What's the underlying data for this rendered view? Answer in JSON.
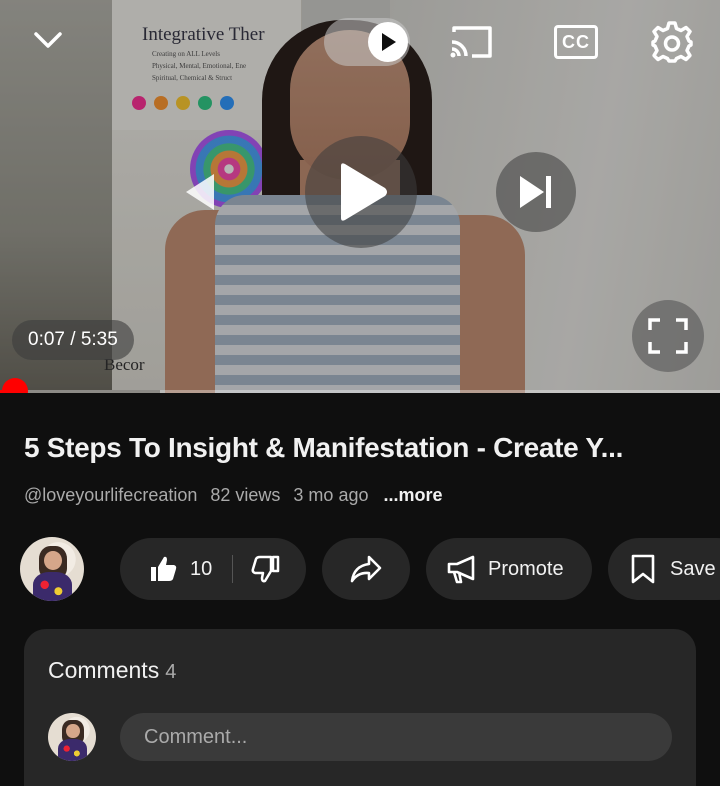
{
  "player": {
    "collapse_icon": "chevron-down-icon",
    "autoplay_icon": "play-icon",
    "cast_icon": "cast-icon",
    "cc_label": "CC",
    "settings_icon": "gear-icon",
    "prev_icon": "previous-icon",
    "play_icon": "play-icon",
    "next_icon": "next-icon",
    "time": "0:07 / 5:35",
    "fullscreen_icon": "fullscreen-icon",
    "progress_fraction": 0.021,
    "accent": "#ff0000",
    "scene": {
      "banner_title": "Integrative Ther",
      "banner_sub": "Creating on ALL Levels\nPhysical, Mental, Emotional, Ene\nSpiritual, Chemical & Struct",
      "poster_text": "Becor"
    }
  },
  "video": {
    "title": "5 Steps To Insight & Manifestation - Create Y...",
    "channel": "@loveyourlifecreation",
    "views": "82 views",
    "age": "3 mo ago",
    "more": "...more"
  },
  "actions": {
    "like_icon": "thumbs-up-icon",
    "like_count": "10",
    "dislike_icon": "thumbs-down-icon",
    "share_icon": "share-icon",
    "promote_icon": "megaphone-icon",
    "promote_label": "Promote",
    "save_icon": "bookmark-icon",
    "save_label": "Save"
  },
  "comments": {
    "heading": "Comments",
    "count": "4",
    "placeholder": "Comment..."
  }
}
